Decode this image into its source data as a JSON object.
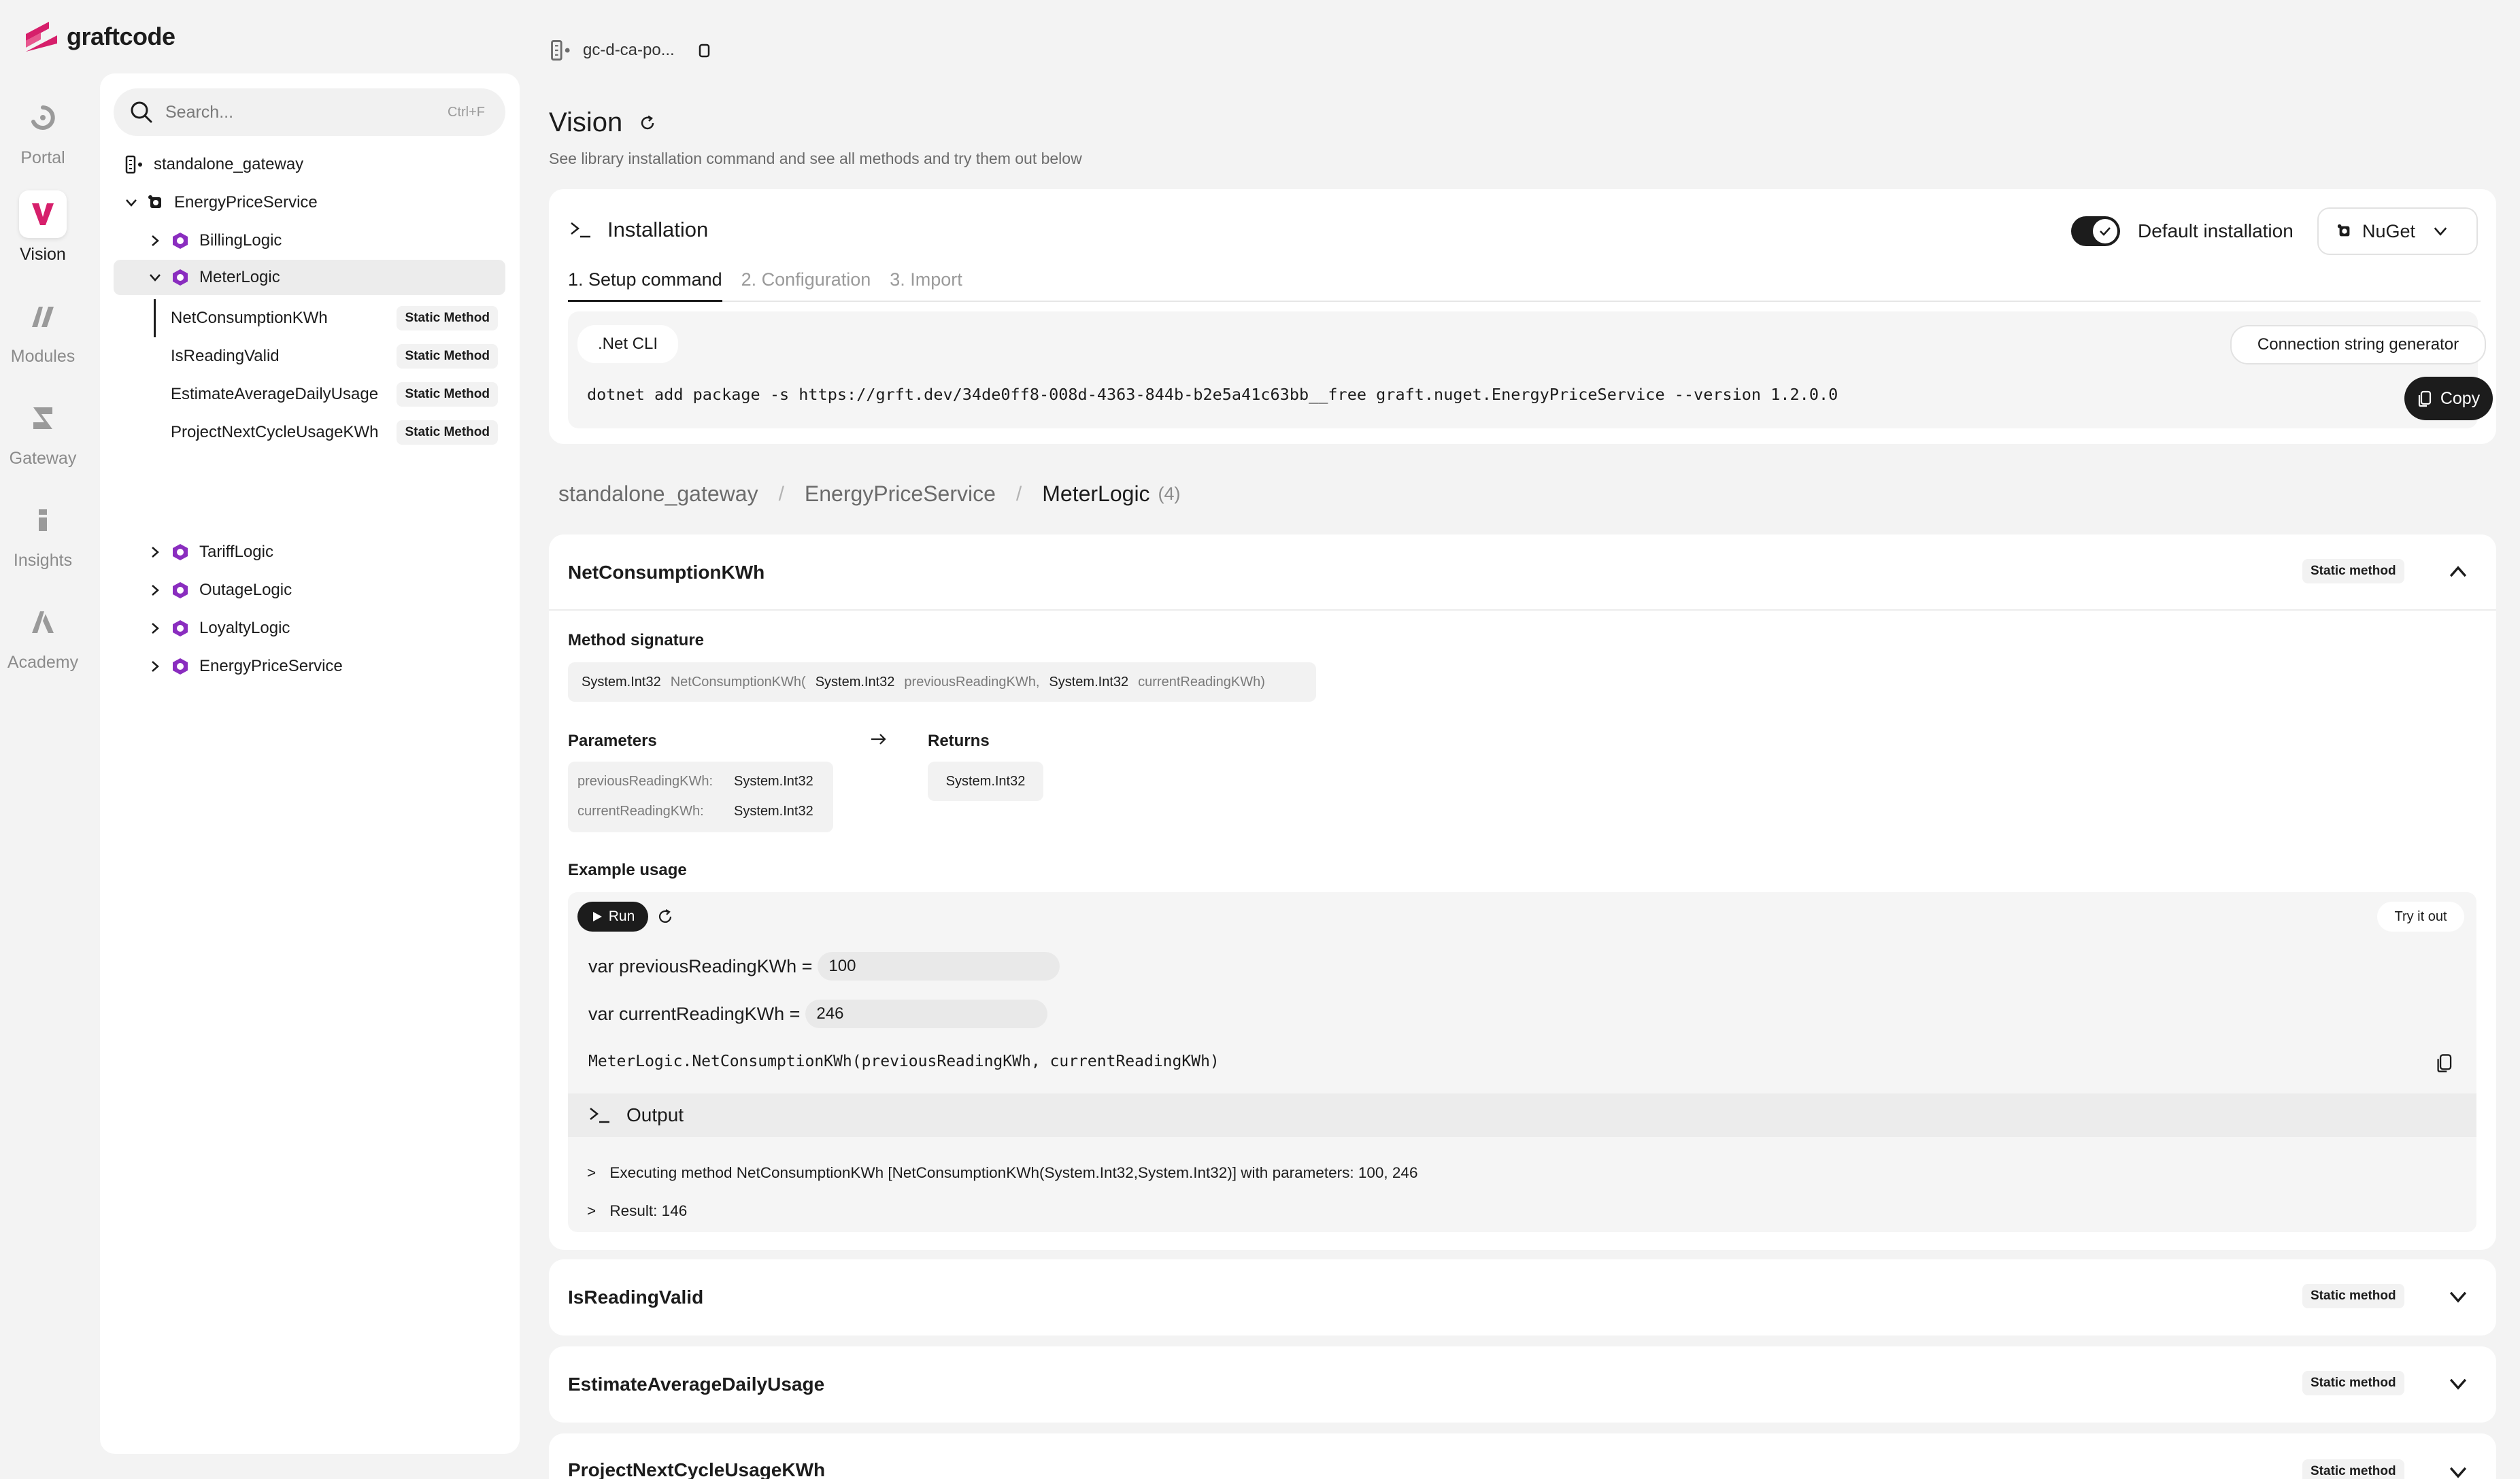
{
  "app": {
    "brand": "graftcode",
    "accent": "#d61f6b"
  },
  "rail": [
    {
      "label": "Portal",
      "icon": "portal-icon",
      "active": false
    },
    {
      "label": "Vision",
      "icon": "vision-icon",
      "active": true
    },
    {
      "label": "Modules",
      "icon": "modules-icon",
      "active": false
    },
    {
      "label": "Gateway",
      "icon": "gateway-icon",
      "active": false
    },
    {
      "label": "Insights",
      "icon": "insights-icon",
      "active": false
    },
    {
      "label": "Academy",
      "icon": "academy-icon",
      "active": false
    }
  ],
  "search": {
    "placeholder": "Search...",
    "shortcut": "Ctrl+F"
  },
  "tree": {
    "gateway": "standalone_gateway",
    "service": "EnergyPriceService",
    "items": [
      "BillingLogic",
      "MeterLogic",
      "TariffLogic",
      "OutageLogic",
      "LoyaltyLogic",
      "EnergyPriceService"
    ],
    "methods": [
      {
        "name": "NetConsumptionKWh",
        "badge": "Static Method"
      },
      {
        "name": "IsReadingValid",
        "badge": "Static Method"
      },
      {
        "name": "EstimateAverageDailyUsage",
        "badge": "Static Method"
      },
      {
        "name": "ProjectNextCycleUsageKWh",
        "badge": "Static Method"
      }
    ]
  },
  "topbar": {
    "gateway_short": "gc-d-ca-po..."
  },
  "page": {
    "title": "Vision",
    "subtitle": "See library installation command and see all methods and try them out below"
  },
  "install": {
    "title": "Installation",
    "toggle_label": "Default installation",
    "package_manager": "NuGet",
    "tabs": [
      "1. Setup command",
      "2. Configuration",
      "3. Import"
    ],
    "cli_label": ".Net CLI",
    "conn_button": "Connection string generator",
    "command": "dotnet add package -s https://grft.dev/34de0ff8-008d-4363-844b-b2e5a41c63bb__free graft.nuget.EnergyPriceService --version 1.2.0.0",
    "copy_label": "Copy"
  },
  "breadcrumb": {
    "gateway": "standalone_gateway",
    "service": "EnergyPriceService",
    "current": "MeterLogic",
    "count": "(4)",
    "sep": "/"
  },
  "method": {
    "name": "NetConsumptionKWh",
    "badge": "Static method",
    "sig_label": "Method signature",
    "sig": {
      "ret_type": "System.Int32",
      "call": "NetConsumptionKWh(",
      "p1_type": "System.Int32",
      "p1_name": "previousReadingKWh,",
      "p2_type": "System.Int32",
      "p2_name": "currentReadingKWh)"
    },
    "params_label": "Parameters",
    "params": [
      {
        "name": "previousReadingKWh:",
        "type": "System.Int32"
      },
      {
        "name": "currentReadingKWh:",
        "type": "System.Int32"
      }
    ],
    "returns_label": "Returns",
    "returns": "System.Int32",
    "example_label": "Example usage",
    "run_label": "Run",
    "try_label": "Try it out",
    "var1_label": "var previousReadingKWh =",
    "var1_value": "100",
    "var2_label": "var currentReadingKWh =",
    "var2_value": "246",
    "call_line": "MeterLogic.NetConsumptionKWh(previousReadingKWh, currentReadingKWh)",
    "output_label": "Output",
    "output": [
      "Executing method NetConsumptionKWh [NetConsumptionKWh(System.Int32,System.Int32)] with parameters: 100, 246",
      "Result: 146"
    ],
    "prompt": ">"
  },
  "other_methods": [
    {
      "name": "IsReadingValid",
      "badge": "Static method"
    },
    {
      "name": "EstimateAverageDailyUsage",
      "badge": "Static method"
    },
    {
      "name": "ProjectNextCycleUsageKWh",
      "badge": "Static method"
    }
  ]
}
